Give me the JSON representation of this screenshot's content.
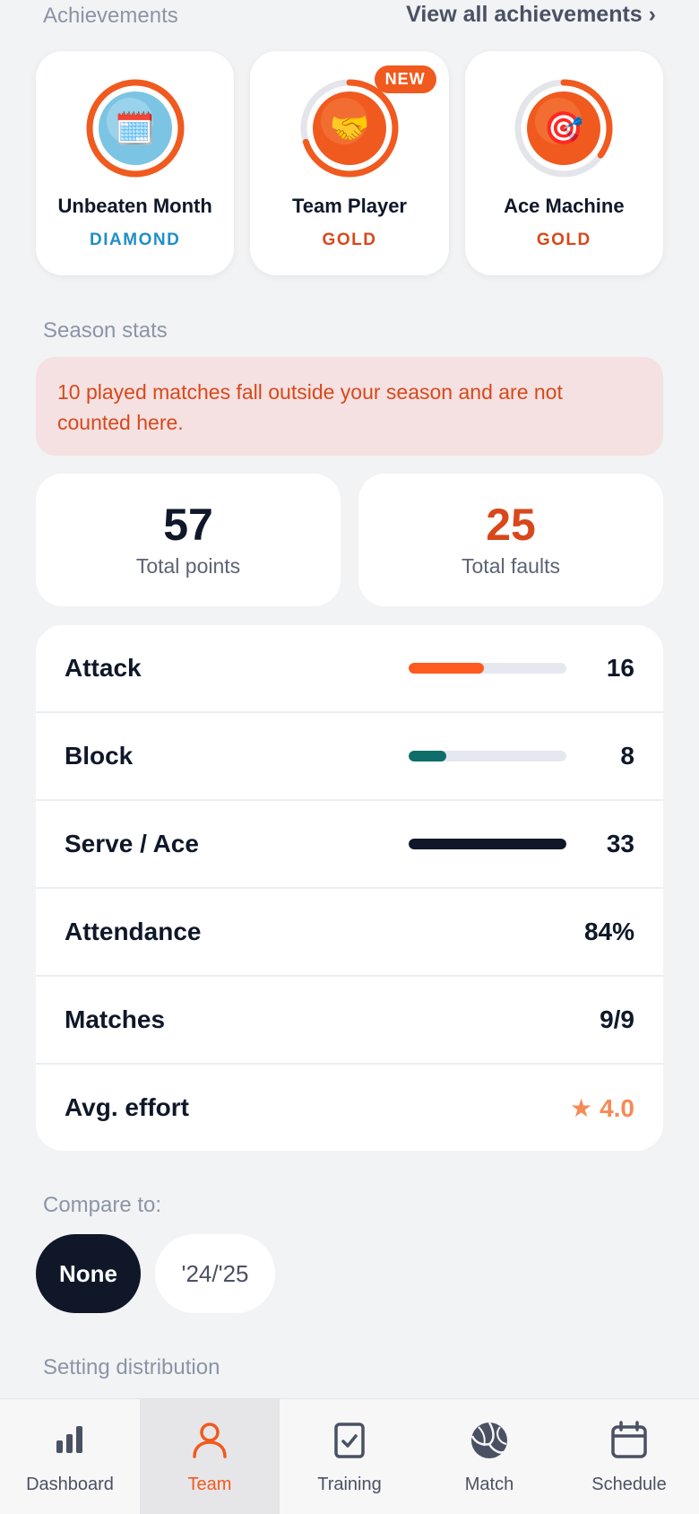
{
  "achievements": {
    "section_label": "Achievements",
    "view_all_label": "View all achievements ›",
    "badges": [
      {
        "name": "Unbeaten Month",
        "tier": "DIAMOND",
        "tier_color": "#1f8fc7",
        "icon": "calendar-icon",
        "emoji": "🗓️",
        "progress": 1.0,
        "is_new": false
      },
      {
        "name": "Team Player",
        "tier": "GOLD",
        "tier_color": "#d8481b",
        "icon": "handshake-icon",
        "emoji": "🤝",
        "progress": 0.7,
        "is_new": true,
        "new_label": "NEW"
      },
      {
        "name": "Ace Machine",
        "tier": "GOLD",
        "tier_color": "#d8481b",
        "icon": "target-icon",
        "emoji": "🎯",
        "progress": 0.35,
        "is_new": false
      }
    ]
  },
  "season": {
    "section_label": "Season stats",
    "notice": "10 played matches fall outside your season and are not counted here.",
    "totals": [
      {
        "value": "57",
        "label": "Total points",
        "color": "#0f1729"
      },
      {
        "value": "25",
        "label": "Total faults",
        "color": "#d8481b"
      }
    ],
    "rows": [
      {
        "label": "Attack",
        "value": "16",
        "bar": 0.48,
        "bar_color": "#ff5a1f"
      },
      {
        "label": "Block",
        "value": "8",
        "bar": 0.24,
        "bar_color": "#0f6e6a"
      },
      {
        "label": "Serve / Ace",
        "value": "33",
        "bar": 1.0,
        "bar_color": "#0f1729"
      },
      {
        "label": "Attendance",
        "value": "84%"
      },
      {
        "label": "Matches",
        "value": "9/9"
      },
      {
        "label": "Avg. effort",
        "value": "4.0",
        "star": "★",
        "icon": "star-icon"
      }
    ]
  },
  "compare": {
    "section_label": "Compare to:",
    "options": [
      {
        "label": "None",
        "selected": true
      },
      {
        "label": "'24/'25",
        "selected": false
      }
    ]
  },
  "setting_distribution": {
    "section_label": "Setting distribution"
  },
  "nav": {
    "items": [
      {
        "label": "Dashboard",
        "icon": "bar-chart-icon",
        "active": false
      },
      {
        "label": "Team",
        "icon": "person-icon",
        "active": true
      },
      {
        "label": "Training",
        "icon": "clipboard-check-icon",
        "active": false
      },
      {
        "label": "Match",
        "icon": "volleyball-icon",
        "active": false
      },
      {
        "label": "Schedule",
        "icon": "calendar-icon",
        "active": false
      }
    ],
    "active_color": "#f05a1f"
  }
}
